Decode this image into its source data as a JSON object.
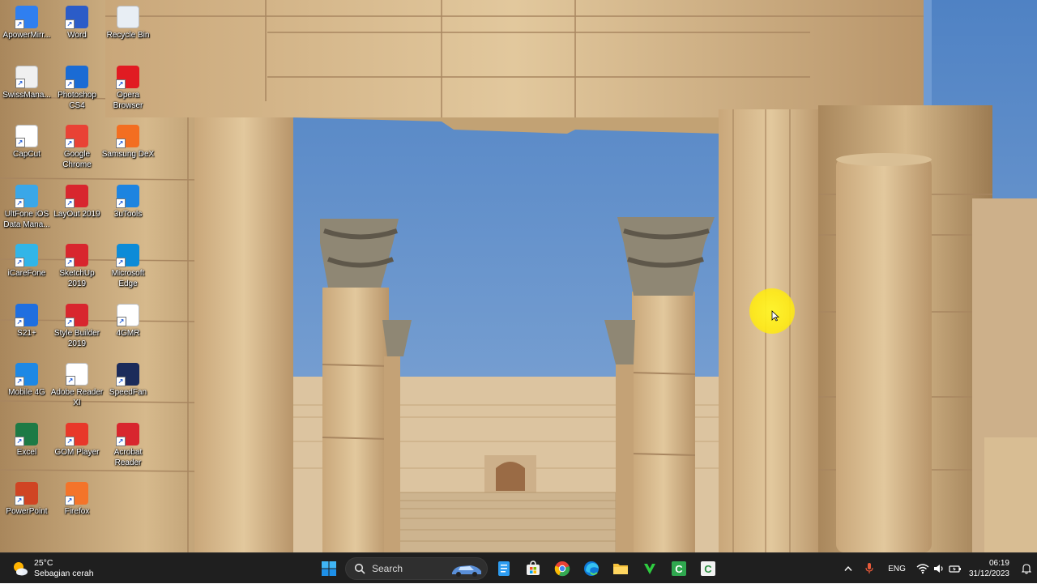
{
  "desktop": {
    "icons": [
      {
        "label": "ApowerMirr...",
        "icon": "apowermirror-icon",
        "color": "#2f7ff0"
      },
      {
        "label": "Word",
        "icon": "word-icon",
        "color": "#2b5cc8"
      },
      {
        "label": "Recycle Bin",
        "icon": "recycle-bin-icon",
        "color": "#e8eef4"
      },
      {
        "label": "SwissMana...",
        "icon": "swissmanager-icon",
        "color": "#f0f0f0"
      },
      {
        "label": "Photoshop CS4",
        "icon": "photoshop-icon",
        "color": "#1a6bd4"
      },
      {
        "label": "Opera Browser",
        "icon": "opera-icon",
        "color": "#e11b22"
      },
      {
        "label": "CapCut",
        "icon": "capcut-icon",
        "color": "#ffffff"
      },
      {
        "label": "Google Chrome",
        "icon": "chrome-icon",
        "color": "#e94235"
      },
      {
        "label": "Samsung DeX",
        "icon": "samsung-dex-icon",
        "color": "#f36e21"
      },
      {
        "label": "UltFone iOS Data Mana...",
        "icon": "ultfone-icon",
        "color": "#3aa7e8"
      },
      {
        "label": "LayOut 2019",
        "icon": "layout-icon",
        "color": "#d8262e"
      },
      {
        "label": "3uTools",
        "icon": "3utools-icon",
        "color": "#1d84e0"
      },
      {
        "label": "iCareFone",
        "icon": "icarefone-icon",
        "color": "#32b5e8"
      },
      {
        "label": "SketchUp 2019",
        "icon": "sketchup-icon",
        "color": "#d8262e"
      },
      {
        "label": "Microsoft Edge",
        "icon": "edge-icon",
        "color": "#0c8bd8"
      },
      {
        "label": "S21+",
        "icon": "s21-icon",
        "color": "#1f6fe0"
      },
      {
        "label": "Style Builder 2019",
        "icon": "style-builder-icon",
        "color": "#d8262e"
      },
      {
        "label": "4GMR",
        "icon": "file-icon",
        "color": "#ffffff"
      },
      {
        "label": "Mobile 4G",
        "icon": "mobile-4g-icon",
        "color": "#1e88e5"
      },
      {
        "label": "Adobe Reader XI",
        "icon": "file-icon",
        "color": "#ffffff"
      },
      {
        "label": "SpeedFan",
        "icon": "speedfan-icon",
        "color": "#1b2b5a"
      },
      {
        "label": "Excel",
        "icon": "excel-icon",
        "color": "#1d7a45"
      },
      {
        "label": "GOM Player",
        "icon": "gom-player-icon",
        "color": "#e8382a"
      },
      {
        "label": "Acrobat Reader",
        "icon": "acrobat-icon",
        "color": "#d8262e"
      },
      {
        "label": "PowerPoint",
        "icon": "powerpoint-icon",
        "color": "#d04423"
      },
      {
        "label": "Firefox",
        "icon": "firefox-icon",
        "color": "#f4742a"
      }
    ]
  },
  "taskbar": {
    "weather": {
      "temp": "25°C",
      "condition": "Sebagian cerah",
      "icon": "weather-sun-cloud-icon"
    },
    "search": {
      "placeholder": "Search"
    },
    "apps": [
      {
        "name": "start-button",
        "icon": "windows-logo-icon"
      },
      {
        "name": "taskbar-file-app",
        "icon": "notepad-icon"
      },
      {
        "name": "taskbar-store",
        "icon": "store-icon"
      },
      {
        "name": "taskbar-chrome",
        "icon": "chrome-icon"
      },
      {
        "name": "taskbar-edge",
        "icon": "edge-icon"
      },
      {
        "name": "taskbar-file-explorer",
        "icon": "folder-icon"
      },
      {
        "name": "taskbar-app-green",
        "icon": "green-app-icon"
      },
      {
        "name": "taskbar-camtasia-green",
        "icon": "camtasia-icon"
      },
      {
        "name": "taskbar-camtasia-white",
        "icon": "camtasia-icon"
      }
    ],
    "tray": {
      "language": "ENG",
      "time": "06:19",
      "date": "31/12/2023"
    }
  },
  "colors": {
    "taskbar": "#1f1f1f",
    "highlight": "#fff01e",
    "sky": "#6f9bd3"
  }
}
